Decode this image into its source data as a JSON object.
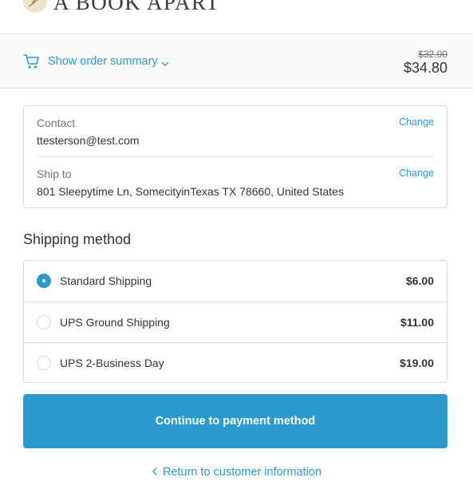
{
  "brand": {
    "name": "A BOOK APART",
    "logo_icon": "leaf-logo-icon"
  },
  "order_summary": {
    "toggle_label": "Show order summary",
    "cart_icon": "cart-icon",
    "chevron_icon": "chevron-down-icon",
    "original_price": "$32.00",
    "total_price": "$34.80"
  },
  "review": {
    "contact": {
      "label": "Contact",
      "value": "ttesterson@test.com",
      "change_label": "Change"
    },
    "ship_to": {
      "label": "Ship to",
      "value": "801 Sleepytime Ln, SomecityinTexas TX 78660, United States",
      "change_label": "Change"
    }
  },
  "shipping": {
    "title": "Shipping method",
    "options": [
      {
        "label": "Standard Shipping",
        "price": "$6.00",
        "selected": true
      },
      {
        "label": "UPS Ground Shipping",
        "price": "$11.00",
        "selected": false
      },
      {
        "label": "UPS 2-Business Day",
        "price": "$19.00",
        "selected": false
      }
    ]
  },
  "actions": {
    "continue_label": "Continue to payment method",
    "return_label": "Return to customer information",
    "return_icon": "chevron-left-icon"
  },
  "colors": {
    "accent": "#2b9acd",
    "text": "#333333",
    "muted": "#737373",
    "border": "#d9d9d9"
  }
}
